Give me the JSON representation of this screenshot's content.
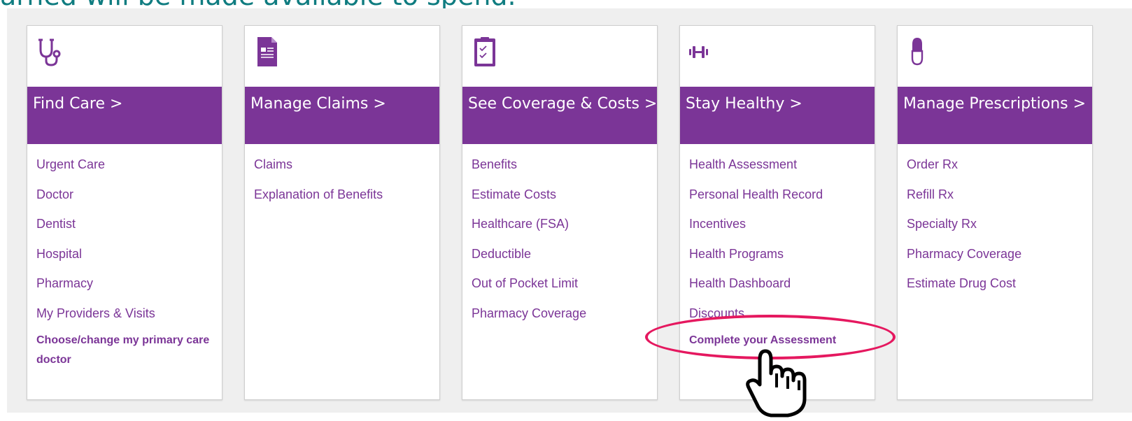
{
  "header": {
    "partial_text": "arned will be made available to spend."
  },
  "colors": {
    "accent": "#7b3597",
    "teal_text": "#0f7c80",
    "highlight": "#e5185f",
    "panel_bg": "#efefef"
  },
  "cards": [
    {
      "icon": "stethoscope-icon",
      "title": "Find Care >",
      "links": [
        "Urgent Care",
        "Doctor",
        "Dentist",
        "Hospital",
        "Pharmacy",
        "My Providers & Visits",
        "Choose/change my primary care doctor"
      ]
    },
    {
      "icon": "document-icon",
      "title": "Manage Claims >",
      "links": [
        "Claims",
        "Explanation of Benefits"
      ]
    },
    {
      "icon": "clipboard-icon",
      "title": "See Coverage & Costs >",
      "links": [
        "Benefits",
        "Estimate Costs",
        "Healthcare (FSA)",
        "Deductible",
        "Out of Pocket Limit",
        "Pharmacy Coverage"
      ]
    },
    {
      "icon": "dumbbell-icon",
      "title": "Stay Healthy >",
      "links": [
        "Health Assessment",
        "Personal Health Record",
        "Incentives",
        "Health Programs",
        "Health Dashboard",
        "Discounts",
        "Complete your Assessment"
      ]
    },
    {
      "icon": "pill-icon",
      "title": "Manage Prescriptions >",
      "links": [
        "Order Rx",
        "Refill Rx",
        "Specialty Rx",
        "Pharmacy Coverage",
        "Estimate Drug Cost"
      ]
    }
  ],
  "annotations": {
    "highlight_target": "Complete your Assessment",
    "cursor_icon": "hand-pointer-icon"
  }
}
